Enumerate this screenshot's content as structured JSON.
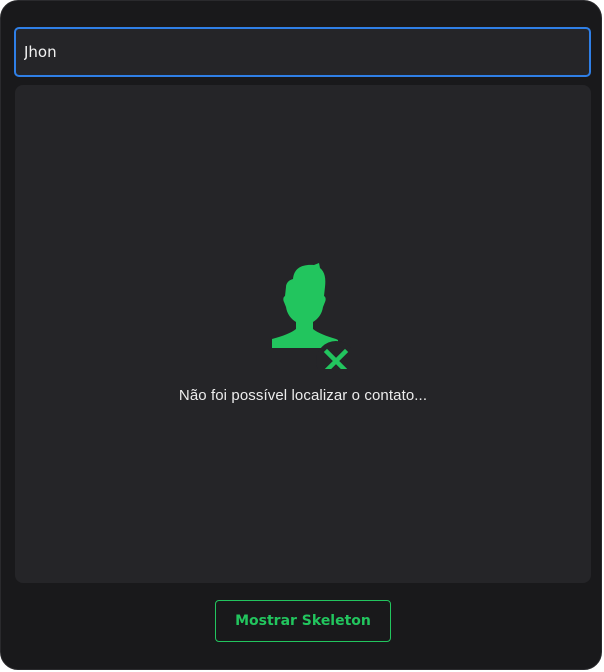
{
  "search": {
    "value": "Jhon"
  },
  "result": {
    "icon": "user-not-found-icon",
    "message": "Não foi possível localizar o contato..."
  },
  "actions": {
    "show_skeleton_label": "Mostrar Skeleton"
  },
  "colors": {
    "accent": "#22c55e",
    "focus_border": "#2f7fe6",
    "background": "#19191b",
    "panel": "#252528"
  }
}
